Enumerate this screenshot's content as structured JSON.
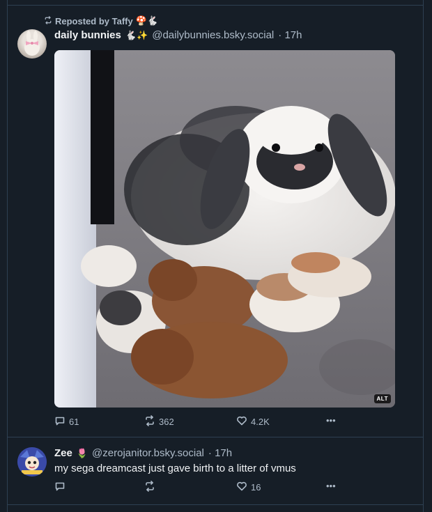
{
  "post1": {
    "repost_label": "Reposted by Taffy",
    "repost_emojis": "🍄🐇",
    "author": {
      "display_name": "daily bunnies",
      "name_emojis": "🐇✨",
      "handle": "@dailybunnies.bsky.social",
      "time": "· 17h"
    },
    "image": {
      "alt_badge": "ALT",
      "description_icon": "bunny-photo"
    },
    "actions": {
      "replies": "61",
      "reposts": "362",
      "likes": "4.2K",
      "more": "•••"
    }
  },
  "post2": {
    "author": {
      "display_name": "Zee",
      "name_emojis": "🌷",
      "handle": "@zerojanitor.bsky.social",
      "time": "· 17h"
    },
    "text": "my sega dreamcast just gave birth to a litter of vmus",
    "actions": {
      "replies": "",
      "reposts": "",
      "likes": "16",
      "more": "•••"
    }
  },
  "colors": {
    "background": "#161e27",
    "border": "#2e4052",
    "text_primary": "#f1f3f5",
    "text_secondary": "#aebbc9"
  }
}
